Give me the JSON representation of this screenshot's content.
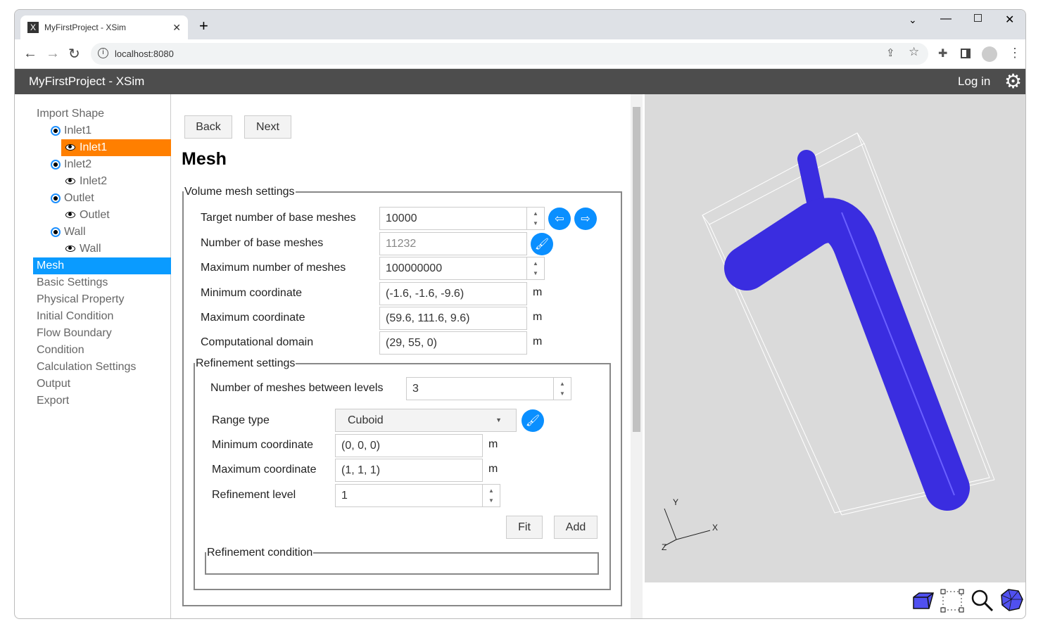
{
  "browser": {
    "tab_title": "MyFirstProject - XSim",
    "url": "localhost:8080"
  },
  "app": {
    "title": "MyFirstProject - XSim",
    "login": "Log in"
  },
  "sidebar": {
    "items": [
      "Import Shape",
      "Inlet1",
      "Inlet1",
      "Inlet2",
      "Inlet2",
      "Outlet",
      "Outlet",
      "Wall",
      "Wall",
      "Mesh",
      "Basic Settings",
      "Physical Property",
      "Initial Condition",
      "Flow Boundary",
      "Condition",
      "Calculation Settings",
      "Output",
      "Export"
    ],
    "selected_shape": "Inlet1",
    "active": "Mesh"
  },
  "colors": {
    "active": "#0a9bff",
    "selected": "#ff7f00",
    "header": "#4d4d4d",
    "model": "#3a2de0"
  },
  "nav": {
    "back": "Back",
    "next": "Next"
  },
  "page_title": "Mesh",
  "volume": {
    "legend": "Volume mesh settings",
    "fields": [
      {
        "label": "Target number of base meshes",
        "value": "10000"
      },
      {
        "label": "Number of base meshes",
        "value": "11232"
      },
      {
        "label": "Maximum number of meshes",
        "value": "100000000"
      },
      {
        "label": "Minimum coordinate",
        "value": "(-1.6, -1.6, -9.6)",
        "unit": "m"
      },
      {
        "label": "Maximum coordinate",
        "value": "(59.6, 111.6, 9.6)",
        "unit": "m"
      },
      {
        "label": "Computational domain",
        "value": "(29, 55, 0)",
        "unit": "m"
      }
    ]
  },
  "refinement": {
    "legend": "Refinement settings",
    "levels_label": "Number of meshes between levels",
    "levels_value": "3",
    "range_label": "Range type",
    "range_value": "Cuboid",
    "min_label": "Minimum coordinate",
    "min_value": "(0, 0, 0)",
    "max_label": "Maximum coordinate",
    "max_value": "(1, 1, 1)",
    "level_label": "Refinement level",
    "level_value": "1",
    "unit": "m",
    "fit": "Fit",
    "add": "Add",
    "condition_legend": "Refinement condition"
  },
  "viewer": {
    "axes": {
      "x": "X",
      "y": "Y",
      "z": "Z"
    },
    "tools": [
      "box-view-icon",
      "select-region-icon",
      "zoom-icon",
      "mesh-view-icon"
    ]
  }
}
